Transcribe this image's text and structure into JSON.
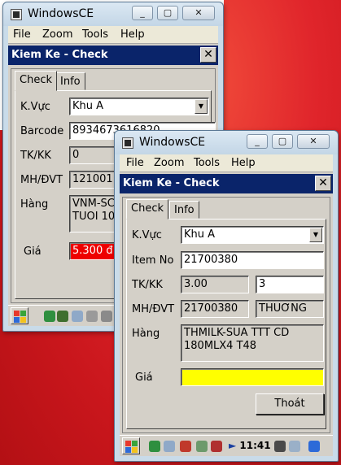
{
  "back_window": {
    "title": "WindowsCE",
    "controls": [
      "_",
      "▢",
      "✕"
    ],
    "menu": [
      "File",
      "Zoom",
      "Tools",
      "Help"
    ],
    "dialog_title": "Kiem Ke - Check",
    "close_glyph": "✕",
    "tabs": [
      "Check",
      "Info"
    ],
    "labels": {
      "kvuc": "K.Vực",
      "barcode": "Barcode",
      "tkkk": "TK/KK",
      "mhdvt": "MH/ĐVT",
      "hang": "Hàng",
      "gia": "Giá"
    },
    "values": {
      "kvuc": "Khu A",
      "barcode": "8934673616820",
      "tkkk": "0",
      "mhdvt": "1210011",
      "hang": "VNM-SCA TUOI 100",
      "gia": "5.300 đ"
    },
    "colors": {
      "gia_bg": "#ee0000"
    }
  },
  "front_window": {
    "title": "WindowsCE",
    "controls": [
      "_",
      "▢",
      "✕"
    ],
    "menu": [
      "File",
      "Zoom",
      "Tools",
      "Help"
    ],
    "dialog_title": "Kiem Ke - Check",
    "close_glyph": "✕",
    "tabs": [
      "Check",
      "Info"
    ],
    "labels": {
      "kvuc": "K.Vực",
      "itemno": "Item No",
      "tkkk": "TK/KK",
      "mhdvt": "MH/ĐVT",
      "hang": "Hàng",
      "gia": "Giá"
    },
    "values": {
      "kvuc": "Khu A",
      "itemno": "21700380",
      "tk": "3.00",
      "kk": "3",
      "mh": "21700380",
      "dvt": "THUƠNG",
      "hang": "THMILK-SUA TTT CD 180MLX4 T48",
      "gia": ""
    },
    "exit_button": "Thoát",
    "colors": {
      "gia_bg": "#ffff00"
    },
    "clock": "11:41"
  }
}
